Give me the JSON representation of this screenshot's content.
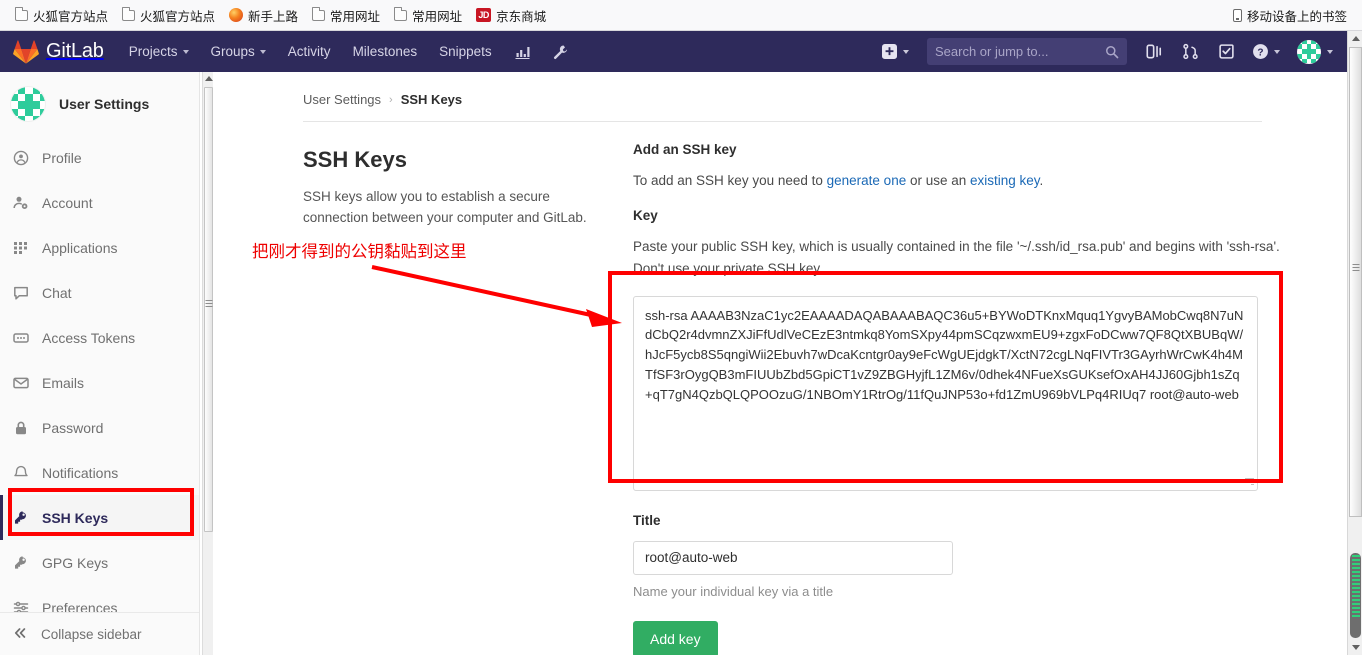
{
  "browser": {
    "bookmarks": [
      {
        "label": "火狐官方站点",
        "icon": "folder-icon"
      },
      {
        "label": "火狐官方站点",
        "icon": "folder-icon"
      },
      {
        "label": "新手上路",
        "icon": "firefox-icon"
      },
      {
        "label": "常用网址",
        "icon": "folder-icon"
      },
      {
        "label": "常用网址",
        "icon": "folder-icon"
      },
      {
        "label": "京东商城",
        "icon": "jd-icon"
      }
    ],
    "mobile_bookmarks": {
      "label": "移动设备上的书签",
      "icon": "mobile-device-icon"
    }
  },
  "navbar": {
    "brand": "GitLab",
    "links": [
      {
        "label": "Projects",
        "caret": true
      },
      {
        "label": "Groups",
        "caret": true
      },
      {
        "label": "Activity",
        "caret": false
      },
      {
        "label": "Milestones",
        "caret": false
      },
      {
        "label": "Snippets",
        "caret": false
      }
    ],
    "icon_links": [
      {
        "name": "analytics-chart-icon"
      },
      {
        "name": "wrench-admin-icon"
      }
    ],
    "new_button": {
      "name": "plus-new-icon",
      "caret": true
    },
    "search": {
      "placeholder": "Search or jump to...",
      "value": ""
    },
    "right_icons": [
      {
        "name": "issues-board-icon"
      },
      {
        "name": "merge-requests-icon"
      },
      {
        "name": "todos-check-icon"
      },
      {
        "name": "help-question-icon",
        "caret": true
      }
    ],
    "user_menu": {
      "name": "user-avatar",
      "caret": true
    }
  },
  "sidebar": {
    "title": "User Settings",
    "items": [
      {
        "label": "Profile",
        "icon": "user-circle-icon",
        "active": false
      },
      {
        "label": "Account",
        "icon": "account-gear-icon",
        "active": false
      },
      {
        "label": "Applications",
        "icon": "grid-apps-icon",
        "active": false
      },
      {
        "label": "Chat",
        "icon": "chat-bubble-icon",
        "active": false
      },
      {
        "label": "Access Tokens",
        "icon": "token-card-icon",
        "active": false
      },
      {
        "label": "Emails",
        "icon": "envelope-icon",
        "active": false
      },
      {
        "label": "Password",
        "icon": "lock-icon",
        "active": false
      },
      {
        "label": "Notifications",
        "icon": "bell-icon",
        "active": false
      },
      {
        "label": "SSH Keys",
        "icon": "key-icon",
        "active": true
      },
      {
        "label": "GPG Keys",
        "icon": "key-icon",
        "active": false
      },
      {
        "label": "Preferences",
        "icon": "sliders-icon",
        "active": false
      }
    ],
    "collapse": {
      "label": "Collapse sidebar",
      "icon": "double-chevron-left-icon"
    }
  },
  "breadcrumb": {
    "parent": "User Settings",
    "separator": "›",
    "current": "SSH Keys"
  },
  "page": {
    "section_title": "SSH Keys",
    "section_desc": "SSH keys allow you to establish a secure connection between your computer and GitLab."
  },
  "form": {
    "heading": "Add an SSH key",
    "intro_pre": "To add an SSH key you need to ",
    "intro_link1": "generate one",
    "intro_mid": " or use an ",
    "intro_link2": "existing key",
    "intro_post": ".",
    "key_label": "Key",
    "key_help": "Paste your public SSH key, which is usually contained in the file '~/.ssh/id_rsa.pub' and begins with 'ssh-rsa'. Don't use your private SSH key.",
    "key_value": "ssh-rsa AAAAB3NzaC1yc2EAAAADAQABAAABAQC36u5+BYWoDTKnxMquq1YgvyBAMobCwq8N7uNdCbQ2r4dvmnZXJiFfUdlVeCEzE3ntmkq8YomSXpy44pmSCqzwxmEU9+zgxFoDCww7QF8QtXBUBqW/hJcF5ycb8S5qngiWii2Ebuvh7wDcaKcntgr0ay9eFcWgUEjdgkT/XctN72cgLNqFIVTr3GAyrhWrCwK4h4MTfSF3rOygQB3mFIUUbZbd5GpiCT1vZ9ZBGHyjfL1ZM6v/0dhek4NFueXsGUKsefOxAH4JJ60Gjbh1sZq+qT7gN4QzbQLQPOOzuG/1NBOmY1RtrOg/11fQuJNP53o+fd1ZmU969bVLPq4RIUq7 root@auto-web",
    "title_label": "Title",
    "title_value": "root@auto-web",
    "title_placeholder": "",
    "title_hint": "Name your individual key via a title",
    "submit_label": "Add key"
  },
  "annotations": {
    "note_text": "把刚才得到的公钥黏贴到这里",
    "color": "#fe0000"
  },
  "colors": {
    "navbar_bg": "#2e2a5b",
    "link_blue": "#1b69b6",
    "button_green": "#31ad63",
    "annotation_red": "#fe0000",
    "identicon_green": "#2ecc9b"
  }
}
